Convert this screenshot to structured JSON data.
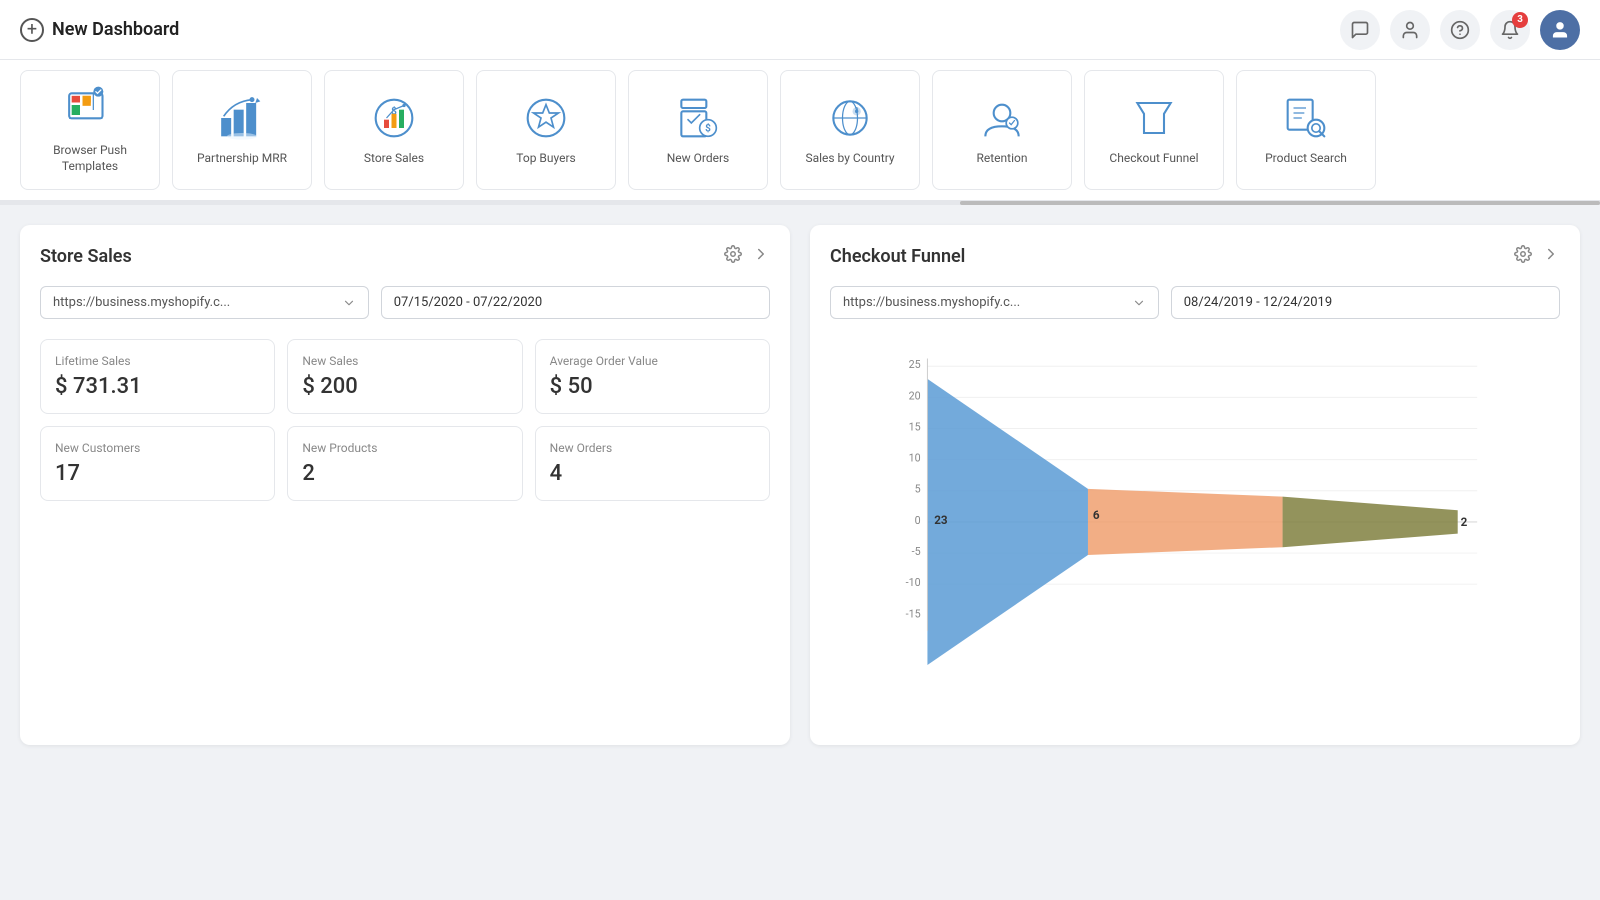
{
  "header": {
    "title": "New Dashboard",
    "add_icon_label": "+",
    "icons": [
      {
        "name": "chat-icon",
        "symbol": "💬",
        "active": false
      },
      {
        "name": "user-icon",
        "symbol": "👤",
        "active": false
      },
      {
        "name": "help-icon",
        "symbol": "?",
        "active": false
      },
      {
        "name": "bell-icon",
        "symbol": "🔔",
        "badge": "3",
        "active": false
      },
      {
        "name": "user-avatar-icon",
        "symbol": "👤",
        "active": true
      }
    ]
  },
  "widget_bar": {
    "items": [
      {
        "id": "browser-push",
        "label": "Browser Push Templates",
        "icon": "browser-push"
      },
      {
        "id": "partnership-mrr",
        "label": "Partnership MRR",
        "icon": "partnership-mrr"
      },
      {
        "id": "store-sales",
        "label": "Store Sales",
        "icon": "store-sales"
      },
      {
        "id": "top-buyers",
        "label": "Top Buyers",
        "icon": "top-buyers"
      },
      {
        "id": "new-orders",
        "label": "New Orders",
        "icon": "new-orders"
      },
      {
        "id": "sales-by-country",
        "label": "Sales by Country",
        "icon": "sales-by-country"
      },
      {
        "id": "retention",
        "label": "Retention",
        "icon": "retention"
      },
      {
        "id": "checkout-funnel",
        "label": "Checkout Funnel",
        "icon": "checkout-funnel"
      },
      {
        "id": "product-search",
        "label": "Product Search",
        "icon": "product-search"
      }
    ]
  },
  "store_sales_panel": {
    "title": "Store Sales",
    "store_url": "https://business.myshopify.c...",
    "date_range": "07/15/2020 - 07/22/2020",
    "stats": [
      {
        "label": "Lifetime Sales",
        "value": "$ 731.31"
      },
      {
        "label": "New Sales",
        "value": "$ 200"
      },
      {
        "label": "Average Order Value",
        "value": "$ 50"
      },
      {
        "label": "New Customers",
        "value": "17"
      },
      {
        "label": "New Products",
        "value": "2"
      },
      {
        "label": "New Orders",
        "value": "4"
      }
    ]
  },
  "checkout_funnel_panel": {
    "title": "Checkout Funnel",
    "store_url": "https://business.myshopify.c...",
    "date_range": "08/24/2019 - 12/24/2019",
    "chart": {
      "y_axis": [
        25,
        20,
        15,
        10,
        5,
        0,
        -5,
        -10,
        -15
      ],
      "labels": [
        "23",
        "6",
        "2"
      ],
      "colors": [
        "#5b9bd5",
        "#f4a460",
        "#808000"
      ]
    }
  }
}
